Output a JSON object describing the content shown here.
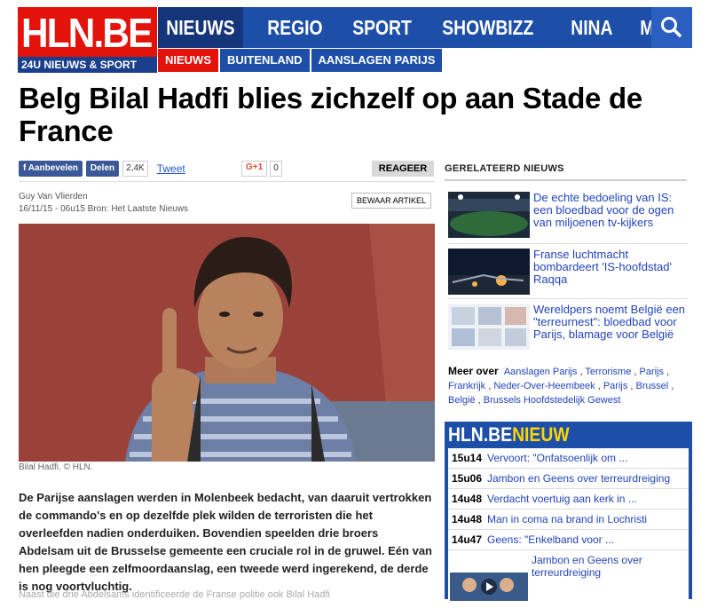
{
  "brand": {
    "logo": "HLN.BE",
    "tagline": "24U NIEUWS & SPORT"
  },
  "nav": {
    "items": [
      "NIEUWS",
      "REGIO",
      "SPORT",
      "SHOWBIZZ",
      "NINA",
      "MEER HLN",
      "-"
    ],
    "search_icon": "search-icon"
  },
  "breadcrumb": [
    "NIEUWS",
    "BUITENLAND",
    "AANSLAGEN PARIJS"
  ],
  "article": {
    "title": "Belg Bilal Hadfi blies zichzelf op aan Stade de France",
    "share": {
      "facebook": "Aanbevelen",
      "share": "Delen",
      "count": "2,4K",
      "tweet": "Tweet",
      "gplus": "G+1",
      "gplus_count": "0"
    },
    "reageer": "REAGEER",
    "author": "Guy Van Vlierden",
    "dateline": "16/11/15 - 06u15  Bron: Het Laatste Nieuws",
    "save": "BEWAAR ARTIKEL",
    "caption": "Bilal Hadfi. © HLN.",
    "lead": "De Parijse aanslagen werden in Molenbeek bedacht, van daaruit vertrokken de commando's en op dezelfde plek wilden de terroristen die het overleefden nadien onderduiken. Bovendien speelden drie broers Abdelsam uit de Brusselse gemeente een cruciale rol in de gruwel. Eén van hen pleegde een zelfmoordaanslag, een tweede werd ingerekend, de derde is nog voortvluchtig.",
    "next_line": "Naast die drie Abdelsams identificeerde de Franse politie ook Bilal Hadfi"
  },
  "related": {
    "heading": "GERELATEERD NIEUWS",
    "items": [
      {
        "text": "De echte bedoeling van IS: een bloedbad voor de ogen van miljoenen tv-kijkers"
      },
      {
        "text": "Franse luchtmacht bombardeert 'IS-hoofdstad' Raqqa"
      },
      {
        "text": "Wereldpers noemt België een \"terreurnest\": bloedbad voor Parijs, blamage voor België"
      }
    ],
    "meer_label": "Meer over",
    "tags": [
      "Aanslagen Parijs",
      "Terrorisme",
      "Parijs",
      "Frankrijk",
      "Neder-Over-Heembeek",
      "Parijs",
      "Brussel",
      "België",
      "Brussels Hoofdstedelijk Gewest"
    ]
  },
  "nieuw": {
    "title_a": "HLN.BE",
    "title_b": "NIEUW",
    "items": [
      {
        "time": "15u14",
        "text": "Vervoort: \"Onfatsoenlijk om ..."
      },
      {
        "time": "15u06",
        "text": "Jambon en Geens over terreurdreiging"
      },
      {
        "time": "14u48",
        "text": "Verdacht voertuig aan kerk in ..."
      },
      {
        "time": "14u48",
        "text": "Man in coma na brand in Lochristi"
      },
      {
        "time": "14u47",
        "text": "Geens: \"Enkelband voor ..."
      },
      {
        "time": "",
        "text": "Jambon en Geens over terreurdreiging"
      }
    ]
  },
  "colors": {
    "brand_red": "#e3120b",
    "brand_blue": "#1d4fa8",
    "link": "#2244bb",
    "accent_yellow": "#ffd400"
  }
}
